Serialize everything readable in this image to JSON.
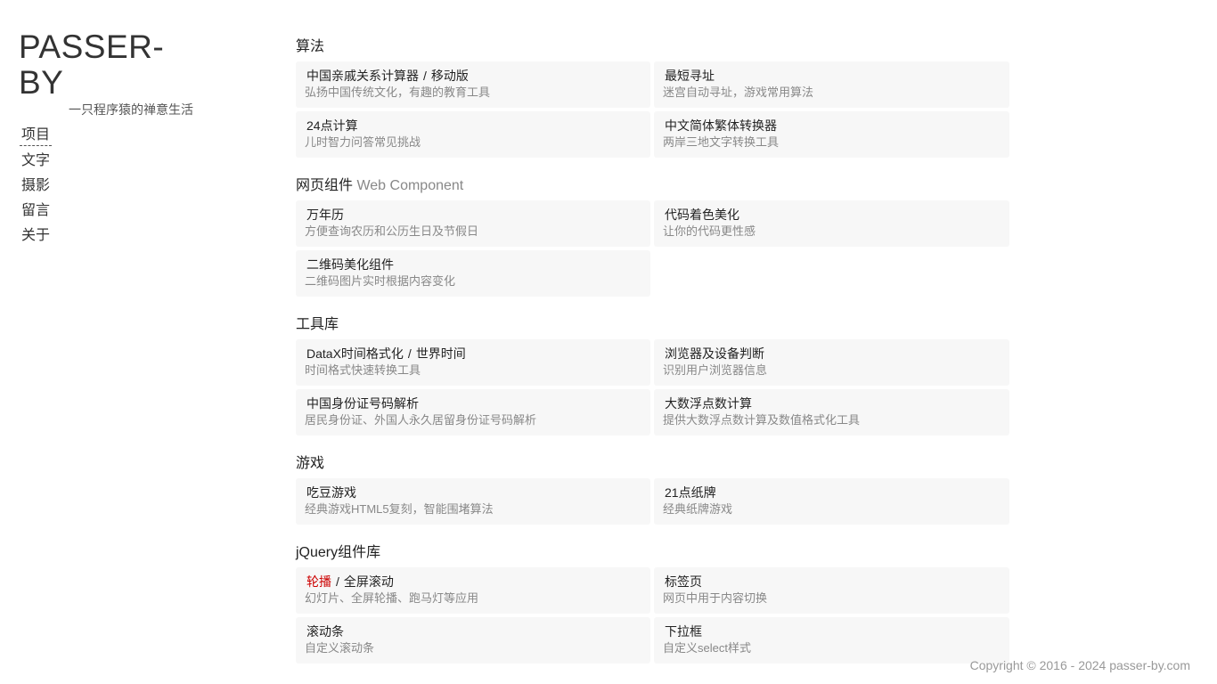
{
  "brand": {
    "title": "PASSER-BY",
    "tagline": "一只程序猿的禅意生活"
  },
  "nav": [
    {
      "label": "项目",
      "active": true
    },
    {
      "label": "文字"
    },
    {
      "label": "摄影"
    },
    {
      "label": "留言"
    },
    {
      "label": "关于"
    }
  ],
  "sections": [
    {
      "title": "算法",
      "subtitle": "",
      "items": [
        {
          "title": "中国亲戚关系计算器",
          "title2": "移动版",
          "desc": "弘扬中国传统文化，有趣的教育工具"
        },
        {
          "title": "最短寻址",
          "desc": "迷宫自动寻址，游戏常用算法"
        },
        {
          "title": "24点计算",
          "desc": "儿时智力问答常见挑战"
        },
        {
          "title": "中文简体繁体转换器",
          "desc": "两岸三地文字转换工具"
        }
      ]
    },
    {
      "title": "网页组件",
      "subtitle": "Web Component",
      "items": [
        {
          "title": "万年历",
          "desc": "方便查询农历和公历生日及节假日"
        },
        {
          "title": "代码着色美化",
          "desc": "让你的代码更性感"
        },
        {
          "title": "二维码美化组件",
          "desc": "二维码图片实时根据内容变化"
        }
      ]
    },
    {
      "title": "工具库",
      "subtitle": "",
      "items": [
        {
          "title": "DataX时间格式化",
          "title2": "世界时间",
          "desc": "时间格式快速转换工具"
        },
        {
          "title": "浏览器及设备判断",
          "desc": "识别用户浏览器信息"
        },
        {
          "title": "中国身份证号码解析",
          "desc": "居民身份证、外国人永久居留身份证号码解析"
        },
        {
          "title": "大数浮点数计算",
          "desc": "提供大数浮点数计算及数值格式化工具"
        }
      ]
    },
    {
      "title": "游戏",
      "subtitle": "",
      "items": [
        {
          "title": "吃豆游戏",
          "desc": "经典游戏HTML5复刻，智能围堵算法"
        },
        {
          "title": "21点纸牌",
          "desc": "经典纸牌游戏"
        }
      ]
    },
    {
      "title": "jQuery组件库",
      "subtitle": "",
      "items": [
        {
          "title": "轮播",
          "title_hot": true,
          "title2": "全屏滚动",
          "desc": "幻灯片、全屏轮播、跑马灯等应用"
        },
        {
          "title": "标签页",
          "desc": "网页中用于内容切换"
        },
        {
          "title": "滚动条",
          "desc": "自定义滚动条"
        },
        {
          "title": "下拉框",
          "desc": "自定义select样式"
        }
      ]
    }
  ],
  "footer": {
    "copyright": "Copyright © 2016 - 2024 passer-by.com"
  },
  "colors": {
    "highlight": "#cc0000",
    "card_bg": "#f7f7f7"
  }
}
